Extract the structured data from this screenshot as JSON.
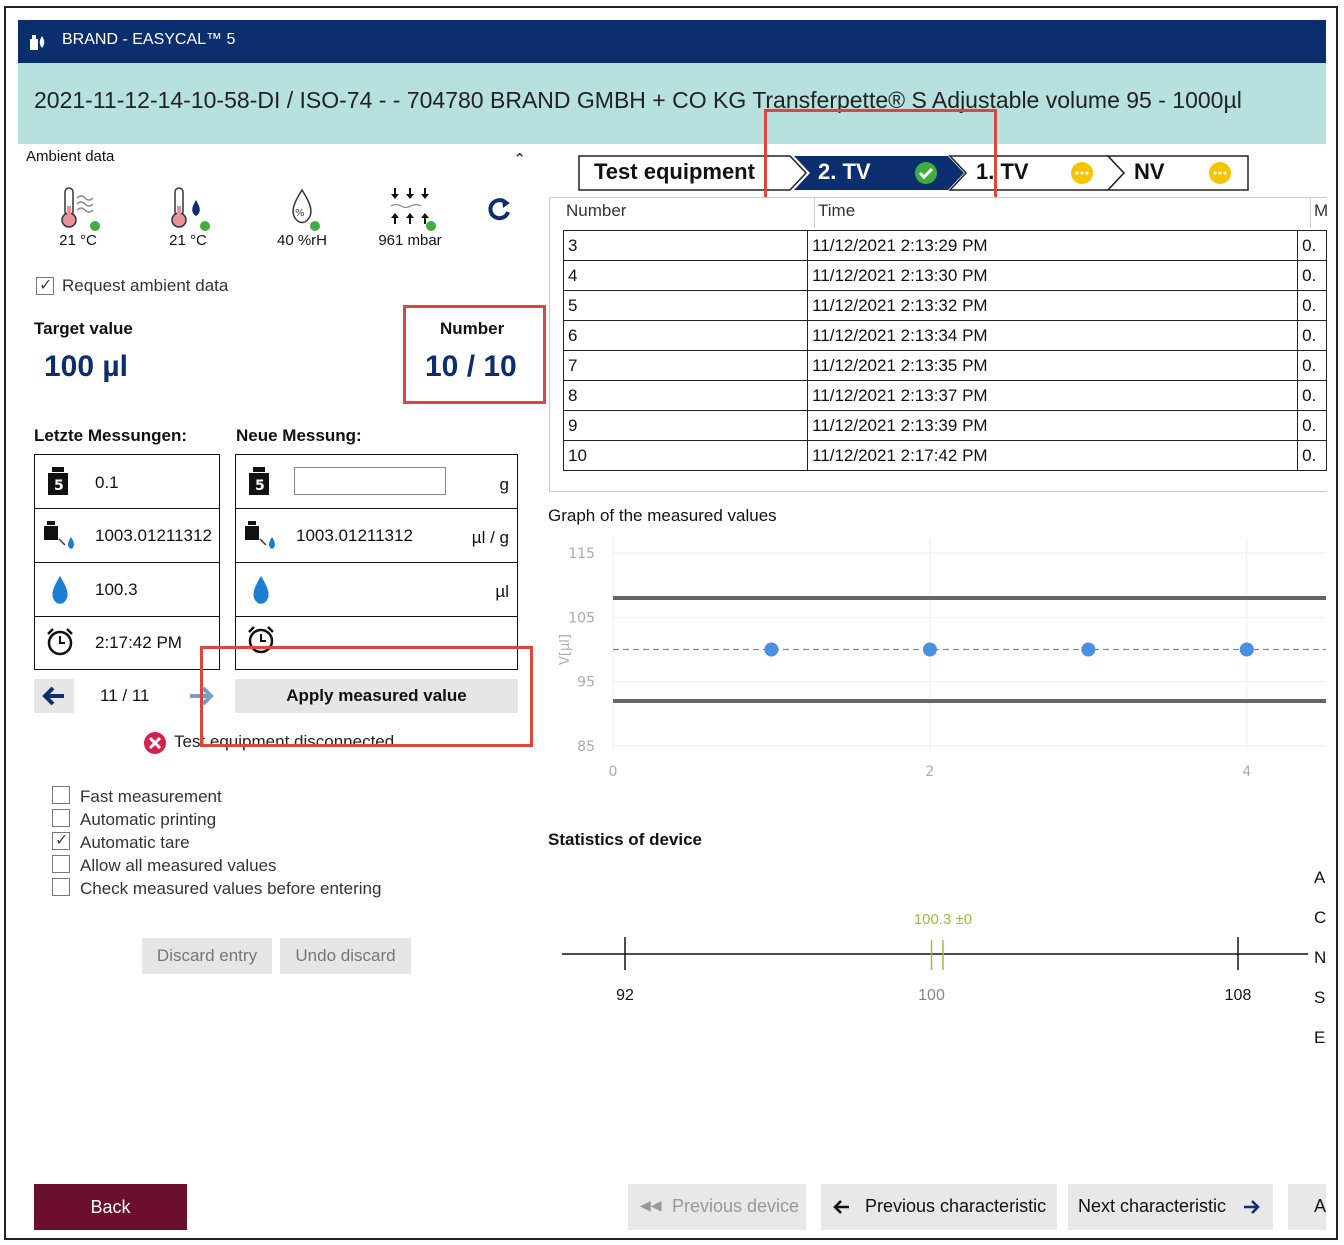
{
  "window": {
    "title": "BRAND - EASYCAL™ 5"
  },
  "header": {
    "info": "2021-11-12-14-10-58-DI / ISO-74 -  - 704780 BRAND GMBH + CO KG Transferpette® S Adjustable volume 95 - 1000µl"
  },
  "ambient": {
    "title": "Ambient data",
    "temp_air": "21 °C",
    "temp_water": "21 °C",
    "humidity": "40 %rH",
    "pressure": "961 mbar",
    "request_label": "Request ambient data",
    "request_checked": true
  },
  "target": {
    "label": "Target value",
    "value": "100 µl"
  },
  "number": {
    "label": "Number",
    "value": "10 / 10"
  },
  "last": {
    "title": "Letzte Messungen:",
    "weight": "0.1",
    "factor": "1003.01211312",
    "volume": "100.3",
    "time": "2:17:42 PM"
  },
  "new": {
    "title": "Neue Messung:",
    "weight_value": "",
    "weight_unit": "g",
    "factor": "1003.01211312",
    "factor_unit": "µl / g",
    "volume_unit": "µl"
  },
  "pager": {
    "value": "11 / 11"
  },
  "apply_label": "Apply measured value",
  "status": {
    "text": "Test equipment disconnected",
    "color": "#d6204e"
  },
  "options": [
    {
      "label": "Fast measurement",
      "checked": false
    },
    {
      "label": "Automatic printing",
      "checked": false
    },
    {
      "label": "Automatic tare",
      "checked": true
    },
    {
      "label": "Allow all measured values",
      "checked": false
    },
    {
      "label": "Check measured values before entering",
      "checked": false
    }
  ],
  "discard_label": "Discard entry",
  "undo_label": "Undo discard",
  "steps": [
    {
      "label": "Test equipment",
      "status": "none"
    },
    {
      "label": "2. TV",
      "status": "done"
    },
    {
      "label": "1. TV",
      "status": "pending"
    },
    {
      "label": "NV",
      "status": "pending"
    }
  ],
  "table": {
    "headers": [
      "Number",
      "Time",
      "M"
    ],
    "rows": [
      [
        "3",
        "11/12/2021 2:13:29 PM",
        "0."
      ],
      [
        "4",
        "11/12/2021 2:13:30 PM",
        "0."
      ],
      [
        "5",
        "11/12/2021 2:13:32 PM",
        "0."
      ],
      [
        "6",
        "11/12/2021 2:13:34 PM",
        "0."
      ],
      [
        "7",
        "11/12/2021 2:13:35 PM",
        "0."
      ],
      [
        "8",
        "11/12/2021 2:13:37 PM",
        "0."
      ],
      [
        "9",
        "11/12/2021 2:13:39 PM",
        "0."
      ],
      [
        "10",
        "11/12/2021 2:17:42 PM",
        "0."
      ]
    ]
  },
  "chart_data": {
    "type": "scatter",
    "title": "Graph of the measured values",
    "ylabel": "V[µl]",
    "xlabel": "",
    "ylim": [
      85,
      115
    ],
    "xlim": [
      0,
      4.5
    ],
    "yticks": [
      115,
      105,
      95,
      85
    ],
    "xticks": [
      0,
      2,
      4
    ],
    "limits": [
      108,
      92
    ],
    "target": 100,
    "points": [
      {
        "x": 1,
        "y": 100
      },
      {
        "x": 2,
        "y": 100
      },
      {
        "x": 3,
        "y": 100
      },
      {
        "x": 4,
        "y": 100
      }
    ],
    "grid": true
  },
  "stats": {
    "title": "Statistics of device",
    "mean_label": "100.3 ±0",
    "mean": 100.3,
    "min": 92,
    "max": 108,
    "center": 100,
    "min_label": "92",
    "center_label": "100",
    "max_label": "108",
    "right_letters": [
      "A",
      "C",
      "N",
      "S",
      "E"
    ]
  },
  "nav": {
    "back": "Back",
    "prev_device": "Previous device",
    "prev_char": "Previous characteristic",
    "next_char": "Next characteristic",
    "last": "A"
  },
  "colors": {
    "titlebar": "#0b2f6e",
    "infobar": "#b6e1de",
    "accent": "#0b2f6e",
    "back": "#6b0f2e",
    "highlight": "#e0443f",
    "point": "#4a90e2",
    "mean": "#9fbf3a",
    "ok": "#3fae3f",
    "pending": "#f5c400"
  }
}
